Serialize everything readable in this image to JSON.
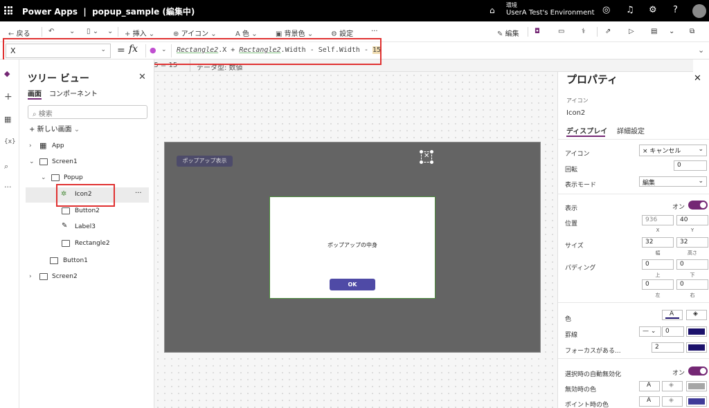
{
  "header": {
    "app_name": "Power Apps",
    "separator": "|",
    "file": "popup_sample (編集中)",
    "env_label": "環境",
    "env_name": "UserA Test's Environment"
  },
  "toolbar": {
    "back": "戻る",
    "insert": "挿入",
    "icon": "アイコン",
    "color": "色",
    "background": "背景色",
    "settings": "設定",
    "more": "···",
    "edit": "編集"
  },
  "formula": {
    "property": "X",
    "equals": "=",
    "fx": "fx",
    "ref1": "Rectangle2",
    "t1": ".X + ",
    "ref2": "Rectangle2",
    "t2": ".Width - ",
    "self": "Self",
    "t3": ".Width - ",
    "num": "15",
    "hint_eval": "15  =  15",
    "hint_type": "データ型: 数値"
  },
  "tree": {
    "title": "ツリー ビュー",
    "tab_screens": "画面",
    "tab_components": "コンポーネント",
    "search_placeholder": "検索",
    "new_screen": "新しい画面",
    "items": [
      {
        "label": "App"
      },
      {
        "label": "Screen1"
      },
      {
        "label": "Popup"
      },
      {
        "label": "Icon2"
      },
      {
        "label": "Button2"
      },
      {
        "label": "Label3"
      },
      {
        "label": "Rectangle2"
      },
      {
        "label": "Button1"
      },
      {
        "label": "Screen2"
      }
    ],
    "more": "···"
  },
  "canvas": {
    "popup_button": "ポップアップ表示",
    "popup_text": "ポップアップの中身",
    "ok": "OK"
  },
  "props": {
    "title": "プロパティ",
    "type": "アイコン",
    "name": "Icon2",
    "tab_display": "ディスプレイ",
    "tab_advanced": "詳細設定",
    "icon_label": "アイコン",
    "icon_value": "× キャンセル",
    "rotation_label": "回転",
    "rotation_value": "0",
    "display_mode_label": "表示モード",
    "display_mode_value": "編集",
    "visible_label": "表示",
    "visible_value": "オン",
    "position_label": "位置",
    "pos_x": "936",
    "pos_y": "40",
    "x": "X",
    "y": "Y",
    "size_label": "サイズ",
    "width": "32",
    "height": "32",
    "w": "幅",
    "h": "高さ",
    "padding_label": "パディング",
    "pad_top": "0",
    "pad_bottom": "0",
    "pad_left": "0",
    "pad_right": "0",
    "top": "上",
    "bottom": "下",
    "left": "左",
    "right": "右",
    "color_label": "色",
    "border_label": "罫線",
    "border_width": "0",
    "focus_label": "フォーカスがある...",
    "focus_width": "2",
    "auto_disable_label": "選択時の自動無効化",
    "auto_disable_value": "オン",
    "disabled_color_label": "無効時の色",
    "hover_color_label": "ポイント時の色",
    "colors": {
      "accent": "#742774",
      "border": "#1b116b",
      "focus": "#1b116b",
      "disabled": "#a6a6a6",
      "hover": "#3f3a98"
    }
  }
}
